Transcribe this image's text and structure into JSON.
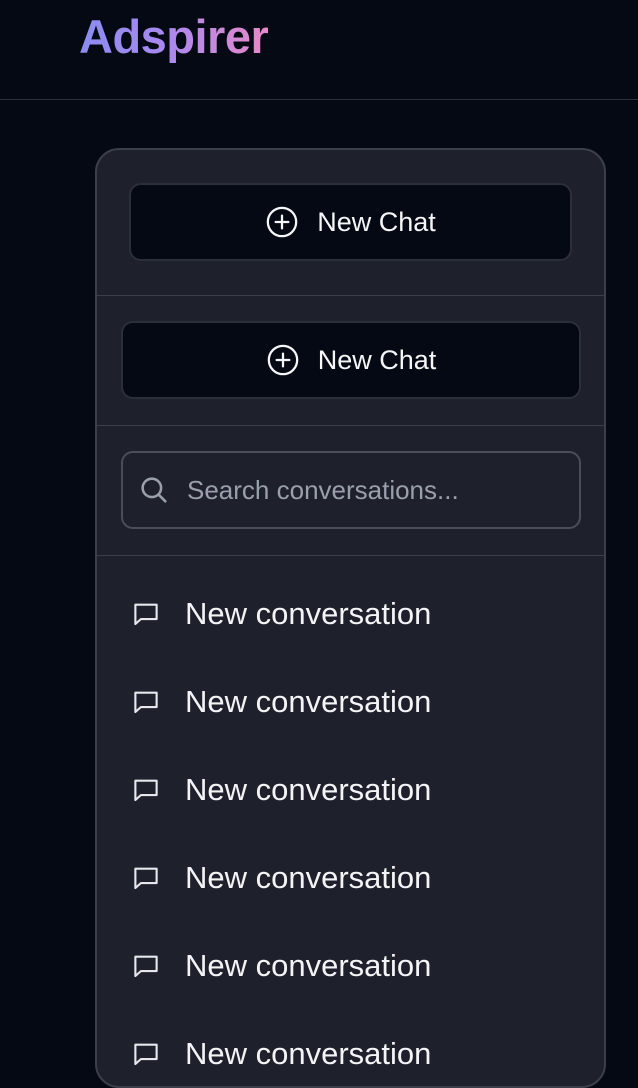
{
  "header": {
    "logo_text": "Adspirer"
  },
  "sidebar": {
    "new_chat_primary": {
      "label": "New Chat",
      "icon": "plus-circle-icon"
    },
    "new_chat_secondary": {
      "label": "New Chat",
      "icon": "plus-circle-icon"
    },
    "search": {
      "placeholder": "Search conversations...",
      "value": "",
      "icon": "search-icon"
    },
    "conversations": [
      {
        "label": "New conversation",
        "icon": "message-square-icon"
      },
      {
        "label": "New conversation",
        "icon": "message-square-icon"
      },
      {
        "label": "New conversation",
        "icon": "message-square-icon"
      },
      {
        "label": "New conversation",
        "icon": "message-square-icon"
      },
      {
        "label": "New conversation",
        "icon": "message-square-icon"
      },
      {
        "label": "New conversation",
        "icon": "message-square-icon"
      }
    ]
  },
  "colors": {
    "background": "#050914",
    "panel": "#1e212c",
    "logo_gradient_start": "#8b8cf0",
    "logo_gradient_end": "#e889c8"
  }
}
